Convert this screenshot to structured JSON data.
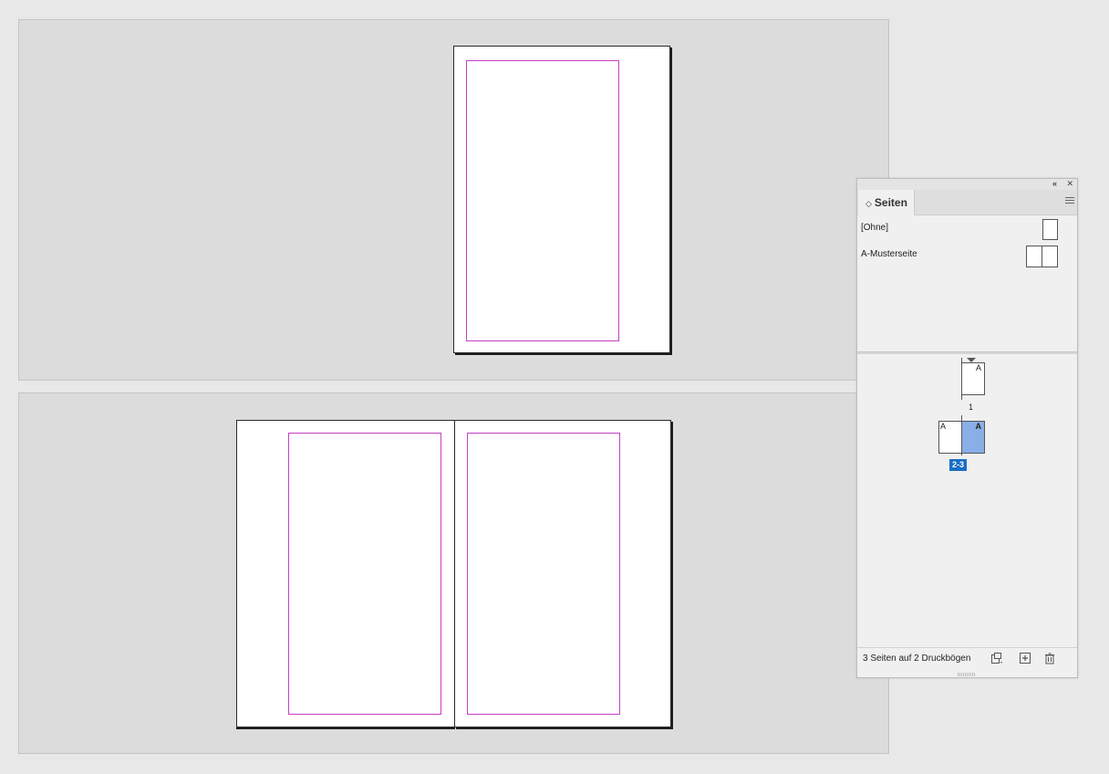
{
  "panel": {
    "title": "Seiten",
    "title_chevron": "⌃",
    "masters": [
      {
        "label": "[Ohne]"
      },
      {
        "label": "A-Musterseite"
      }
    ],
    "pages": [
      {
        "number": "1",
        "master_letter": "A"
      },
      {
        "number": "2-3",
        "master_letters": [
          "A",
          "A"
        ],
        "selected": true
      }
    ],
    "footer": {
      "status": "3 Seiten auf 2 Druckbögen"
    },
    "icons": {
      "collapse": "«",
      "close": "✕"
    }
  },
  "colors": {
    "margin_guide": "#c440c4",
    "selection": "#1a6ec6",
    "selected_page_fill": "#8aaee6"
  }
}
